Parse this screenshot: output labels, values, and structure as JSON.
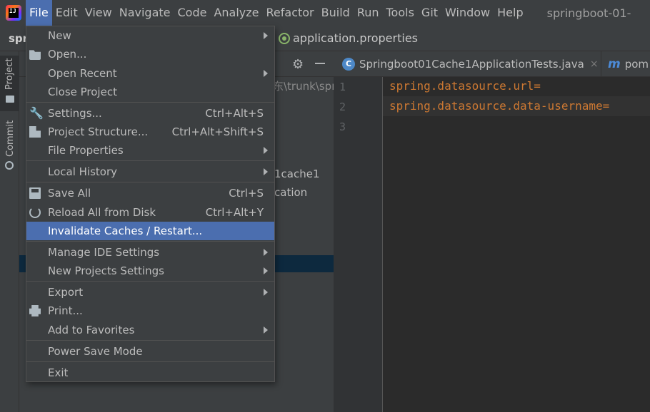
{
  "menubar": {
    "items": [
      "File",
      "Edit",
      "View",
      "Navigate",
      "Code",
      "Analyze",
      "Refactor",
      "Build",
      "Run",
      "Tools",
      "Git",
      "Window",
      "Help"
    ],
    "window_title": "springboot-01-"
  },
  "navbar": {
    "project_name": "spr",
    "file_name": "application.properties"
  },
  "toolstrip": {
    "project_tab": "Project",
    "commit_tab": "Commit"
  },
  "project_panel": {
    "path_fragment": "东\\trunk\\spri",
    "tree_item_1": "1cache1",
    "tree_item_2": "cation"
  },
  "tabs": {
    "tests_tab": "Springboot01Cache1ApplicationTests.java",
    "tests_icon_letter": "C",
    "pom_tab": "pom",
    "pom_icon_letter": "m",
    "close_glyph": "×"
  },
  "editor": {
    "line_numbers": [
      "1",
      "2",
      "3"
    ],
    "lines": [
      "spring.datasource.url=",
      "spring.datasource.data-username=",
      ""
    ]
  },
  "file_menu": {
    "items": {
      "new": {
        "label": "New"
      },
      "open": {
        "label": "Open..."
      },
      "open_recent": {
        "label": "Open Recent"
      },
      "close_project": {
        "label": "Close Project"
      },
      "settings": {
        "label": "Settings...",
        "shortcut": "Ctrl+Alt+S"
      },
      "project_structure": {
        "label": "Project Structure...",
        "shortcut": "Ctrl+Alt+Shift+S"
      },
      "file_properties": {
        "label": "File Properties"
      },
      "local_history": {
        "label": "Local History"
      },
      "save_all": {
        "label": "Save All",
        "shortcut": "Ctrl+S"
      },
      "reload": {
        "label": "Reload All from Disk",
        "shortcut": "Ctrl+Alt+Y"
      },
      "invalidate": {
        "label": "Invalidate Caches / Restart..."
      },
      "manage_ide": {
        "label": "Manage IDE Settings"
      },
      "new_projects": {
        "label": "New Projects Settings"
      },
      "export": {
        "label": "Export"
      },
      "print": {
        "label": "Print..."
      },
      "favorites": {
        "label": "Add to Favorites"
      },
      "power_save": {
        "label": "Power Save Mode"
      },
      "exit": {
        "label": "Exit"
      }
    }
  },
  "colors": {
    "selection": "#4b6eaf",
    "code_key": "#cc7832",
    "background": "#2b2b2b",
    "panel": "#3c3f41"
  }
}
